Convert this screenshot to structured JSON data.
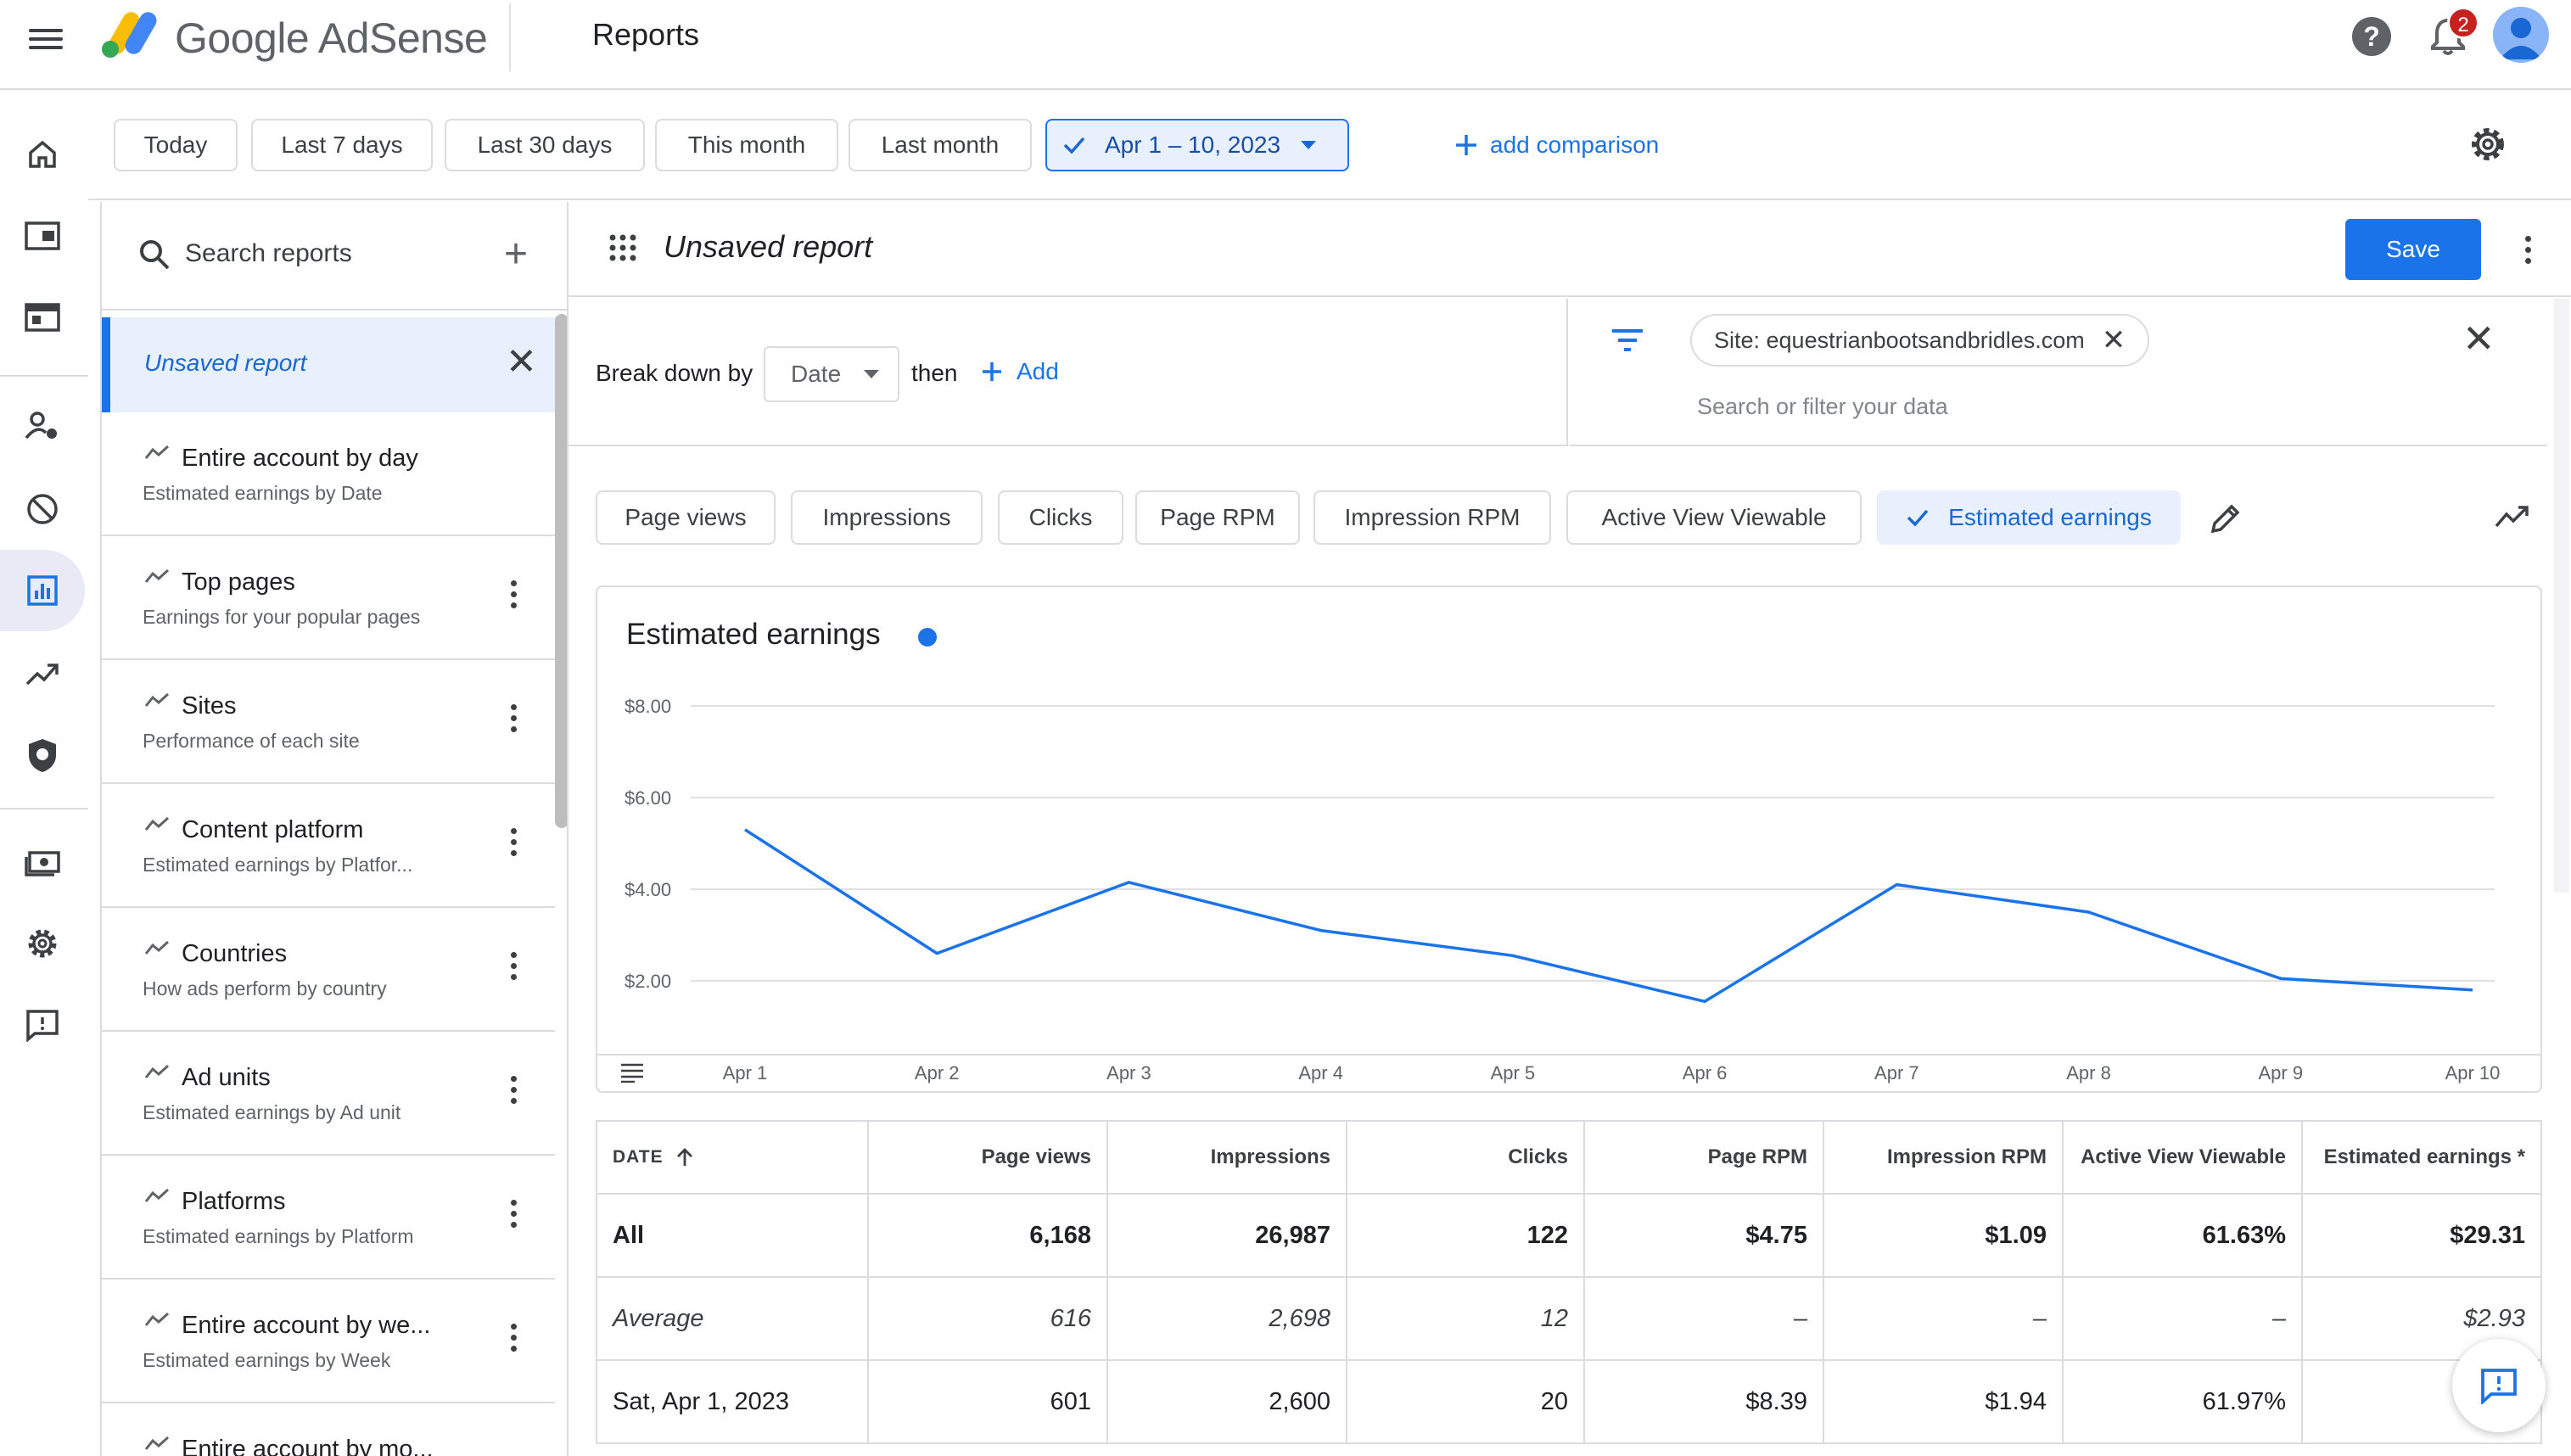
{
  "header": {
    "brand": "Google AdSense",
    "page_title": "Reports",
    "notification_count": "2"
  },
  "date_ranges": [
    "Today",
    "Last 7 days",
    "Last 30 days",
    "This month",
    "Last month"
  ],
  "selected_range": "Apr 1 – 10, 2023",
  "add_comparison": "add comparison",
  "sidebar": {
    "search_label": "Search reports",
    "unsaved_label": "Unsaved report",
    "items": [
      {
        "title": "Entire account by day",
        "subtitle": "Estimated earnings by Date"
      },
      {
        "title": "Top pages",
        "subtitle": "Earnings for your popular pages"
      },
      {
        "title": "Sites",
        "subtitle": "Performance of each site"
      },
      {
        "title": "Content platform",
        "subtitle": "Estimated earnings by Platfor..."
      },
      {
        "title": "Countries",
        "subtitle": "How ads perform by country"
      },
      {
        "title": "Ad units",
        "subtitle": "Estimated earnings by Ad unit"
      },
      {
        "title": "Platforms",
        "subtitle": "Estimated earnings by Platform"
      },
      {
        "title": "Entire account by we...",
        "subtitle": "Estimated earnings by Week"
      },
      {
        "title": "Entire account by mo...",
        "subtitle": ""
      }
    ]
  },
  "report": {
    "name": "Unsaved report",
    "save_label": "Save",
    "breakdown_label": "Break down by",
    "breakdown_value": "Date",
    "then_label": "then",
    "add_label": "Add",
    "filter_chip": "Site: equestrianbootsandbridles.com",
    "filter_placeholder": "Search or filter your data"
  },
  "metrics": [
    "Page views",
    "Impressions",
    "Clicks",
    "Page RPM",
    "Impression RPM",
    "Active View Viewable",
    "Estimated earnings"
  ],
  "active_metric": "Estimated earnings",
  "colors": {
    "accent": "#1a73e8",
    "line": "#1a73e8"
  },
  "chart_data": {
    "type": "line",
    "title": "Estimated earnings",
    "categories": [
      "Apr 1",
      "Apr 2",
      "Apr 3",
      "Apr 4",
      "Apr 5",
      "Apr 6",
      "Apr 7",
      "Apr 8",
      "Apr 9",
      "Apr 10"
    ],
    "series": [
      {
        "values": [
          5.3,
          2.6,
          4.15,
          3.1,
          2.55,
          1.55,
          4.1,
          3.5,
          2.05,
          1.8
        ]
      }
    ],
    "y_ticks": [
      "$2.00",
      "$4.00",
      "$6.00",
      "$8.00"
    ],
    "ylim": [
      0,
      8
    ],
    "grid": true
  },
  "table": {
    "columns": [
      "DATE",
      "Page views",
      "Impressions",
      "Clicks",
      "Page RPM",
      "Impression RPM",
      "Active View Viewable",
      "Estimated earnings *"
    ],
    "rows": [
      {
        "kind": "all",
        "cells": [
          "All",
          "6,168",
          "26,987",
          "122",
          "$4.75",
          "$1.09",
          "61.63%",
          "$29.31"
        ]
      },
      {
        "kind": "avg",
        "cells": [
          "Average",
          "616",
          "2,698",
          "12",
          "–",
          "–",
          "–",
          "$2.93"
        ]
      },
      {
        "kind": "row",
        "cells": [
          "Sat, Apr 1, 2023",
          "601",
          "2,600",
          "20",
          "$8.39",
          "$1.94",
          "61.97%",
          ""
        ]
      }
    ]
  }
}
